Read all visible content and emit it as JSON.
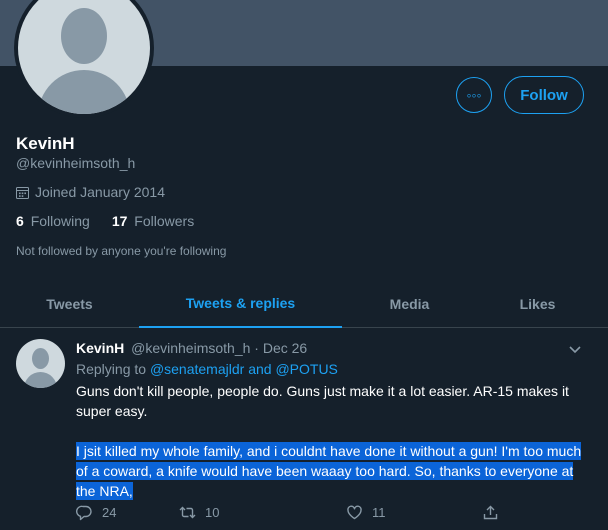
{
  "profile": {
    "display_name": "KevinH",
    "handle": "@kevinheimsoth_h",
    "joined": "Joined January 2014",
    "following_count": "6",
    "following_label": "Following",
    "followers_count": "17",
    "followers_label": "Followers",
    "not_followed_text": "Not followed by anyone you're following",
    "more_icon": "more-dots-icon",
    "follow_label": "Follow"
  },
  "tabs": [
    {
      "label": "Tweets"
    },
    {
      "label": "Tweets & replies",
      "active": true
    },
    {
      "label": "Media"
    },
    {
      "label": "Likes"
    }
  ],
  "tweet": {
    "name": "KevinH",
    "handle": "@kevinheimsoth_h",
    "separator": "·",
    "date": "Dec 26",
    "replying_prefix": "Replying to",
    "mention_1": "@senatemajldr",
    "and_text": "and",
    "mention_2": "@POTUS",
    "paragraph_1": "Guns don't kill people, people do. Guns just make it a lot easier. AR-15 makes it super easy.",
    "paragraph_2": "I jsit killed my whole family, and i couldnt have done it without a gun!  I'm too much of a coward, a knife would have been waaay too hard. So, thanks to everyone at the NRA,",
    "reply_count": "24",
    "retweet_count": "10",
    "like_count": "11"
  },
  "colors": {
    "background": "#15202b",
    "banner": "#425366",
    "accent": "#1da1f2",
    "muted_text": "#8899a6",
    "selection": "#0b64d8"
  }
}
